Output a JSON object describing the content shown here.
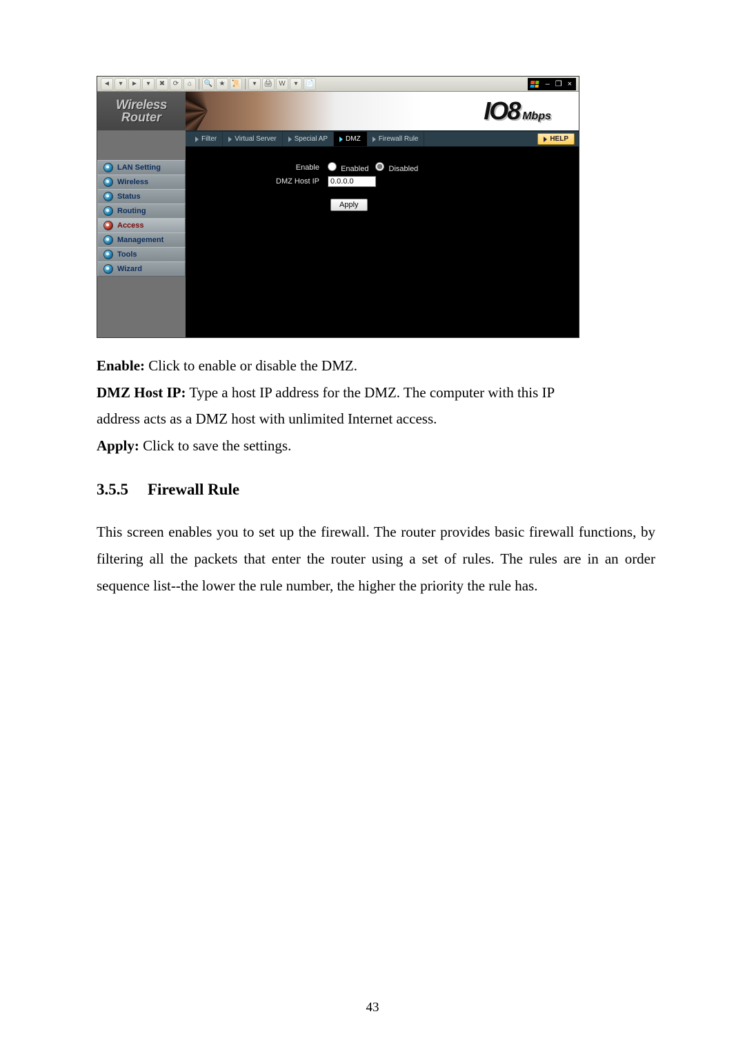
{
  "ie_toolbar": {
    "icons": [
      "◄",
      "▾",
      "►",
      "▾",
      "✖",
      "⟳",
      "⌂",
      "🔍",
      "★",
      "📜",
      "▾",
      "🖨",
      "W",
      "▾",
      "📄"
    ],
    "winctl": [
      "–",
      "❐",
      "×"
    ]
  },
  "brand": {
    "line1": "Wireless",
    "line2": "Router"
  },
  "speed": {
    "num": "IO8",
    "unit": "Mbps"
  },
  "tabs": [
    "Filter",
    "Virtual Server",
    "Special AP",
    "DMZ",
    "Firewall Rule"
  ],
  "active_tab_index": 3,
  "help_label": "HELP",
  "sidebar": {
    "items": [
      {
        "label": "LAN Setting"
      },
      {
        "label": "Wireless"
      },
      {
        "label": "Status"
      },
      {
        "label": "Routing"
      },
      {
        "label": "Access"
      },
      {
        "label": "Management"
      },
      {
        "label": "Tools"
      },
      {
        "label": "Wizard"
      }
    ],
    "active_index": 4
  },
  "form": {
    "enable_label": "Enable",
    "enabled_opt": "Enabled",
    "disabled_opt": "Disabled",
    "enable_value": "disabled",
    "dmz_label": "DMZ Host IP",
    "dmz_value": "0.0.0.0",
    "apply_label": "Apply"
  },
  "doc": {
    "enable_b": "Enable:",
    "enable_t": " Click to enable or disable the DMZ.",
    "dmz_b": "DMZ Host IP:",
    "dmz_t1": " Type a host IP address for the DMZ. The computer with this IP",
    "dmz_t2": "address acts as a DMZ host with unlimited Internet access.",
    "apply_b": "Apply:",
    "apply_t": " Click to save the settings.",
    "sec_num": "3.5.5",
    "sec_title": "Firewall Rule",
    "para": "This screen enables you to set up the firewall. The router provides basic firewall functions, by filtering all the packets that enter the router using a set of rules. The rules are in an order sequence list--the lower the rule number, the higher the priority the rule has."
  },
  "page_number": "43"
}
